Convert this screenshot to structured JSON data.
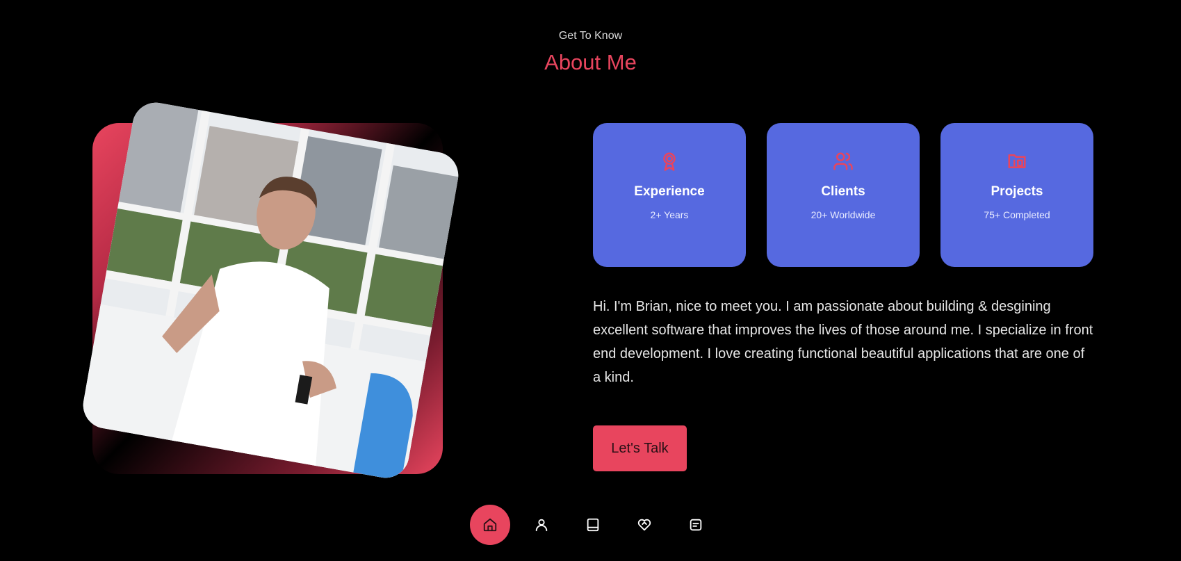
{
  "section": {
    "subtitle": "Get To Know",
    "title": "About Me"
  },
  "cards": [
    {
      "icon": "award-icon",
      "title": "Experience",
      "subtitle": "2+ Years"
    },
    {
      "icon": "users-icon",
      "title": "Clients",
      "subtitle": "20+ Worldwide"
    },
    {
      "icon": "folder-icon",
      "title": "Projects",
      "subtitle": "75+ Completed"
    }
  ],
  "bio": "Hi. I'm Brian, nice to meet you. I am passionate about building & desgining excellent software that improves the lives of those around me. I specialize in front end development. I love creating functional beautiful applications that are one of a kind.",
  "cta": {
    "label": "Let's Talk"
  },
  "nav": [
    {
      "icon": "home-icon",
      "active": true
    },
    {
      "icon": "user-icon",
      "active": false
    },
    {
      "icon": "book-icon",
      "active": false
    },
    {
      "icon": "heart-handshake-icon",
      "active": false
    },
    {
      "icon": "message-icon",
      "active": false
    }
  ],
  "colors": {
    "background": "#000000",
    "accent": "#e8455e",
    "card": "#5669e0",
    "text": "#e6e6e6"
  }
}
